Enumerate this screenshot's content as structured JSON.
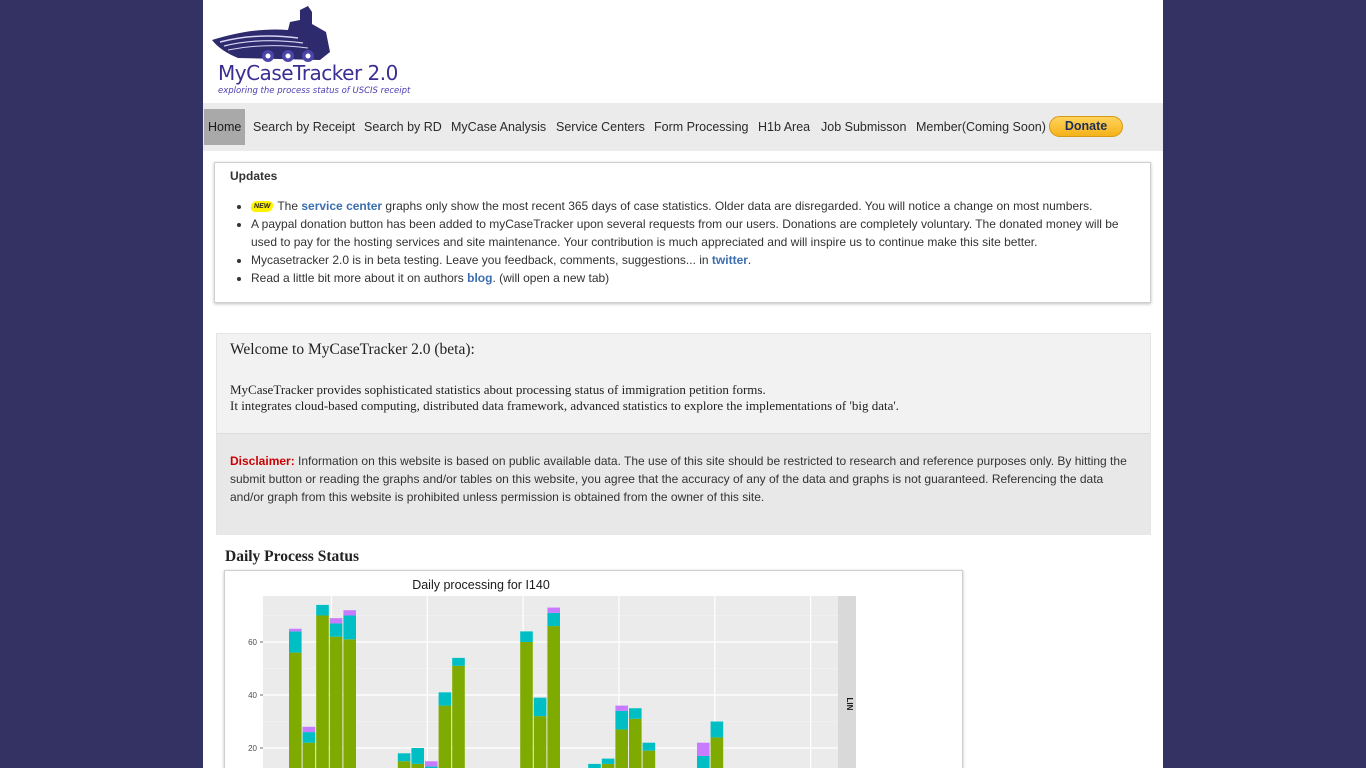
{
  "logo": {
    "title": "MyCaseTracker 2.0",
    "subtitle": "exploring the process status of USCIS receipt"
  },
  "nav": {
    "items": [
      "Home",
      "Search by Receipt",
      "Search by RD",
      "MyCase Analysis",
      "Service Centers",
      "Form Processing",
      "H1b Area",
      "Job Submisson",
      "Member(Coming Soon)"
    ],
    "donate_label": "Donate"
  },
  "updates": {
    "heading": "Updates",
    "badge": "NEW",
    "item1_pre": "The ",
    "item1_link": "service center",
    "item1_post": " graphs only show the most recent 365 days of case statistics. Older data are disregarded. You will notice a change on most numbers.",
    "item2": "A paypal donation button has been added to myCaseTracker upon several requests from our users. Donations are completely voluntary. The donated money will be used to pay for the hosting services and site maintenance. Your contribution is much appreciated and will inspire us to continue make this site better.",
    "item3_pre": "Mycasetracker 2.0 is in beta testing. Leave you feedback, comments, suggestions... in ",
    "item3_link": "twitter",
    "item3_post": ".",
    "item4_pre": "Read a little bit more about it on authors ",
    "item4_link": "blog",
    "item4_post": ". (will open a new tab)"
  },
  "welcome": {
    "title": "Welcome to MyCaseTracker 2.0 (beta):",
    "line1": "MyCaseTracker provides sophisticated statistics about processing status of immigration petition forms.",
    "line2": "It integrates cloud-based computing, distributed data framework, advanced statistics to explore the implementations of 'big data'.",
    "disclaimer_label": "Disclaimer:",
    "disclaimer_text": " Information on this website is based on public available data. The use of this site should be restricted to research and reference purposes only. By hitting the submit button or reading the graphs and/or tables on this website, you agree that the accuracy of any of the data and graphs is not guaranteed. Referencing the data and/or graph from this website is prohibited unless permission is obtained from the owner of this site."
  },
  "daily": {
    "heading": "Daily Process Status"
  },
  "chart_data": {
    "type": "bar",
    "title": "Daily processing for I140",
    "facet_label": "LIN",
    "ylim": [
      0,
      75
    ],
    "yticks": [
      20,
      40,
      60
    ],
    "grid": true,
    "colors": {
      "green": "#7fab00",
      "teal": "#00bfc4",
      "purple": "#c77cff"
    },
    "bars": [
      {
        "green": 56,
        "teal": 8,
        "purple": 1
      },
      {
        "green": 22,
        "teal": 4,
        "purple": 2
      },
      {
        "green": 70,
        "teal": 4,
        "purple": 0
      },
      {
        "green": 62,
        "teal": 5,
        "purple": 2
      },
      {
        "green": 61,
        "teal": 9,
        "purple": 2
      },
      {
        "green": 0,
        "teal": 0,
        "purple": 0
      },
      {
        "green": 0,
        "teal": 0,
        "purple": 0
      },
      {
        "green": 0,
        "teal": 0,
        "purple": 0
      },
      {
        "green": 15,
        "teal": 3,
        "purple": 0
      },
      {
        "green": 14,
        "teal": 6,
        "purple": 0
      },
      {
        "green": 12,
        "teal": 1,
        "purple": 2
      },
      {
        "green": 36,
        "teal": 5,
        "purple": 0
      },
      {
        "green": 51,
        "teal": 3,
        "purple": 0
      },
      {
        "green": 0,
        "teal": 0,
        "purple": 0
      },
      {
        "green": 0,
        "teal": 0,
        "purple": 0
      },
      {
        "green": 0,
        "teal": 0,
        "purple": 1
      },
      {
        "green": 0,
        "teal": 0,
        "purple": 1
      },
      {
        "green": 60,
        "teal": 4,
        "purple": 0
      },
      {
        "green": 32,
        "teal": 7,
        "purple": 0
      },
      {
        "green": 66,
        "teal": 5,
        "purple": 2
      },
      {
        "green": 0,
        "teal": 0,
        "purple": 0
      },
      {
        "green": 0,
        "teal": 0,
        "purple": 0
      },
      {
        "green": 12,
        "teal": 2,
        "purple": 0
      },
      {
        "green": 14,
        "teal": 2,
        "purple": 0
      },
      {
        "green": 27,
        "teal": 7,
        "purple": 2
      },
      {
        "green": 31,
        "teal": 4,
        "purple": 0
      },
      {
        "green": 19,
        "teal": 3,
        "purple": 0
      },
      {
        "green": 0,
        "teal": 0,
        "purple": 0
      },
      {
        "green": 0,
        "teal": 0,
        "purple": 0
      },
      {
        "green": 0,
        "teal": 0,
        "purple": 0
      },
      {
        "green": 12,
        "teal": 5,
        "purple": 5
      },
      {
        "green": 24,
        "teal": 6,
        "purple": 0
      },
      {
        "green": 0,
        "teal": 0,
        "purple": 0
      },
      {
        "green": 0,
        "teal": 0,
        "purple": 0
      },
      {
        "green": 0,
        "teal": 0,
        "purple": 0
      },
      {
        "green": 0,
        "teal": 0,
        "purple": 0
      },
      {
        "green": 0,
        "teal": 0,
        "purple": 0
      },
      {
        "green": 0,
        "teal": 0,
        "purple": 0
      },
      {
        "green": 0,
        "teal": 0,
        "purple": 0
      },
      {
        "green": 0,
        "teal": 0,
        "purple": 0
      },
      {
        "green": 0,
        "teal": 0,
        "purple": 0
      },
      {
        "green": 0,
        "teal": 0,
        "purple": 0
      }
    ]
  }
}
